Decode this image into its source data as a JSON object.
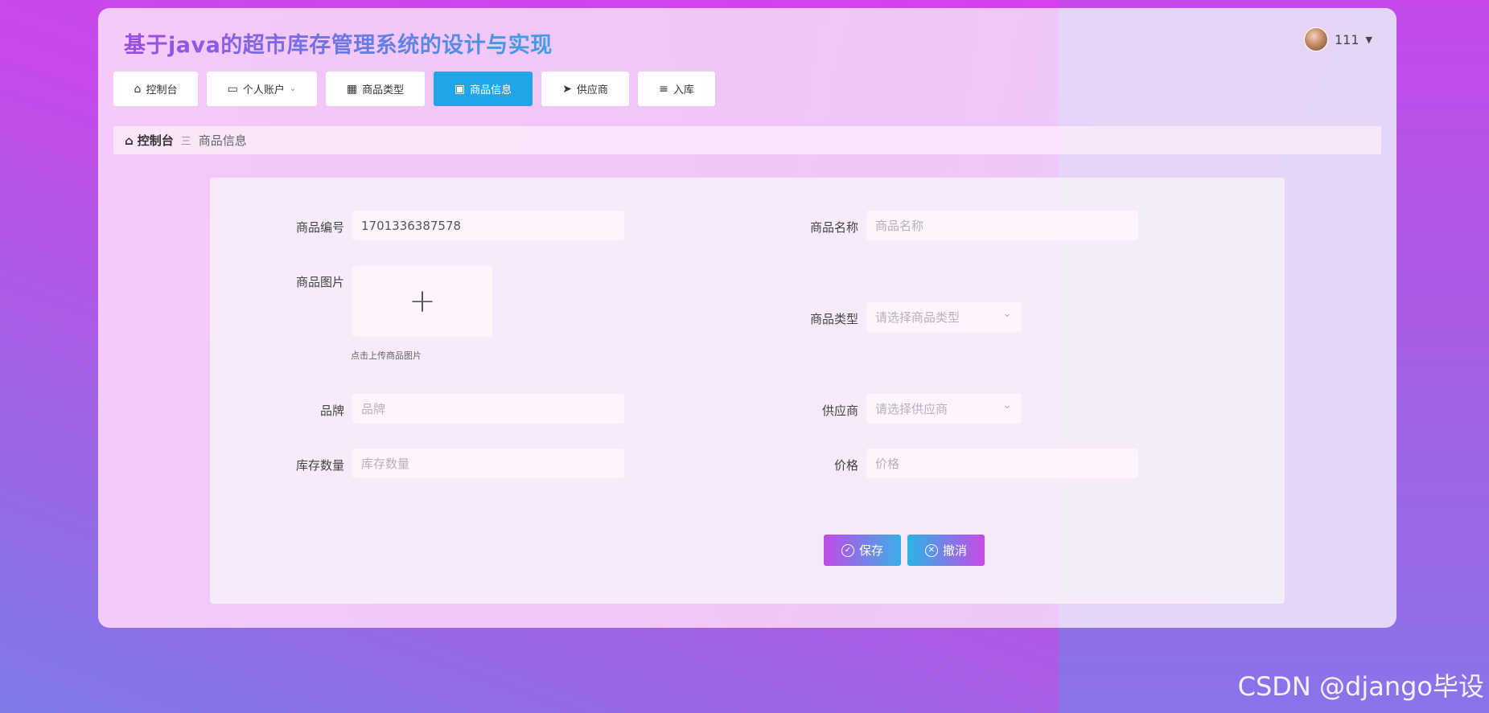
{
  "app": {
    "title": "基于java的超市库存管理系统的设计与实现",
    "user": {
      "name": "111"
    }
  },
  "nav": {
    "items": [
      {
        "label": "控制台",
        "icon": "home-icon"
      },
      {
        "label": "个人账户",
        "icon": "wallet-icon",
        "has_dropdown": true
      },
      {
        "label": "商品类型",
        "icon": "grid-icon"
      },
      {
        "label": "商品信息",
        "icon": "clipboard-icon",
        "active": true
      },
      {
        "label": "供应商",
        "icon": "send-icon"
      },
      {
        "label": "入库",
        "icon": "sliders-icon"
      }
    ]
  },
  "breadcrumb": {
    "home": "控制台",
    "separator": "三",
    "current": "商品信息"
  },
  "form": {
    "product_no": {
      "label": "商品编号",
      "value": "1701336387578"
    },
    "product_name": {
      "label": "商品名称",
      "placeholder": "商品名称"
    },
    "product_image": {
      "label": "商品图片",
      "hint": "点击上传商品图片"
    },
    "product_type": {
      "label": "商品类型",
      "placeholder": "请选择商品类型"
    },
    "brand": {
      "label": "品牌",
      "placeholder": "品牌"
    },
    "supplier": {
      "label": "供应商",
      "placeholder": "请选择供应商"
    },
    "stock_qty": {
      "label": "库存数量",
      "placeholder": "库存数量"
    },
    "price": {
      "label": "价格",
      "placeholder": "价格"
    },
    "save_label": "保存",
    "cancel_label": "撤消"
  },
  "watermark": "CSDN @django毕设",
  "colors": {
    "accent": "#1fa5e8",
    "background": "#d33cf0"
  }
}
